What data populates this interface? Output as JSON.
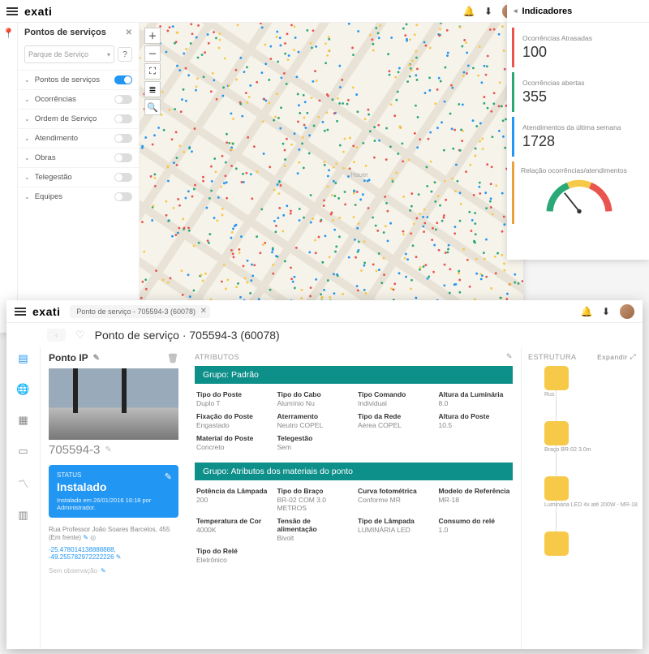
{
  "brand": "exati",
  "top": {
    "sidebar": {
      "title": "Pontos de serviços",
      "parque_placeholder": "Parque de Serviço",
      "layers": [
        {
          "label": "Pontos de serviços",
          "on": true
        },
        {
          "label": "Ocorrências",
          "on": false
        },
        {
          "label": "Ordem de Serviço",
          "on": false
        },
        {
          "label": "Atendimento",
          "on": false
        },
        {
          "label": "Obras",
          "on": false
        },
        {
          "label": "Telegestão",
          "on": false
        },
        {
          "label": "Equipes",
          "on": false
        }
      ]
    },
    "map_label": "Hauer"
  },
  "indicators": {
    "title": "Indicadores",
    "cards": [
      {
        "label": "Ocorrências Atrasadas",
        "value": "100",
        "color": "#e9544f"
      },
      {
        "label": "Ocorrências abertas",
        "value": "355",
        "color": "#2aa876"
      },
      {
        "label": "Atendimentos da última semana",
        "value": "1728",
        "color": "#2196f3"
      }
    ],
    "gauge_label": "Relação ocorrências/atendimentos"
  },
  "detail": {
    "tab": "Ponto de serviço - 705594-3 (60078)",
    "title": "Ponto de serviço · 705594-3 (60078)",
    "ponto_label": "Ponto IP",
    "point_id": "705594-3",
    "status": {
      "k": "STATUS",
      "v": "Instalado",
      "meta": "Instalado em 26/01/2016 16:18 por Administrador."
    },
    "address": "Rua Professor João Soares Barcelos, 455 (Em frente)",
    "coords": "-25.478014138888888, -49.255782972222226",
    "no_obs": "Sem observação",
    "atributos_label": "ATRIBUTOS",
    "estrutura_label": "ESTRUTURA",
    "expand_label": "Expandir",
    "group1": {
      "title": "Grupo: Padrão",
      "attrs": [
        {
          "k": "Tipo do Poste",
          "v": "Duplo T"
        },
        {
          "k": "Tipo do Cabo",
          "v": "Alumínio Nu"
        },
        {
          "k": "Tipo Comando",
          "v": "Individual"
        },
        {
          "k": "Altura da Luminária",
          "v": "8.0"
        },
        {
          "k": "Fixação do Poste",
          "v": "Engastado"
        },
        {
          "k": "Aterramento",
          "v": "Neutro COPEL"
        },
        {
          "k": "Tipo da Rede",
          "v": "Aérea COPEL"
        },
        {
          "k": "Altura do Poste",
          "v": "10.5"
        },
        {
          "k": "Material do Poste",
          "v": "Concreto"
        },
        {
          "k": "Telegestão",
          "v": "Sem"
        }
      ]
    },
    "group2": {
      "title": "Grupo: Atributos dos materiais do ponto",
      "attrs": [
        {
          "k": "Potência da Lâmpada",
          "v": "200"
        },
        {
          "k": "Tipo do Braço",
          "v": "BR-02 COM 3.0 METROS"
        },
        {
          "k": "Curva fotométrica",
          "v": "Conforme MR"
        },
        {
          "k": "Modelo de Referência",
          "v": "MR-18"
        },
        {
          "k": "Temperatura de Cor",
          "v": "4000K"
        },
        {
          "k": "Tensão de alimentação",
          "v": "Bivolt"
        },
        {
          "k": "Tipo de Lâmpada",
          "v": "LUMINÁRIA LED"
        },
        {
          "k": "Consumo do relé",
          "v": "1.0"
        },
        {
          "k": "Tipo do Relé",
          "v": "Eletrônico"
        }
      ]
    },
    "tree": [
      {
        "label": "Rus"
      },
      {
        "label": "Braço BR-02 3.0m"
      },
      {
        "label": "Luminária LED 4x até 200W - MR-18"
      },
      {
        "label": ""
      }
    ]
  }
}
